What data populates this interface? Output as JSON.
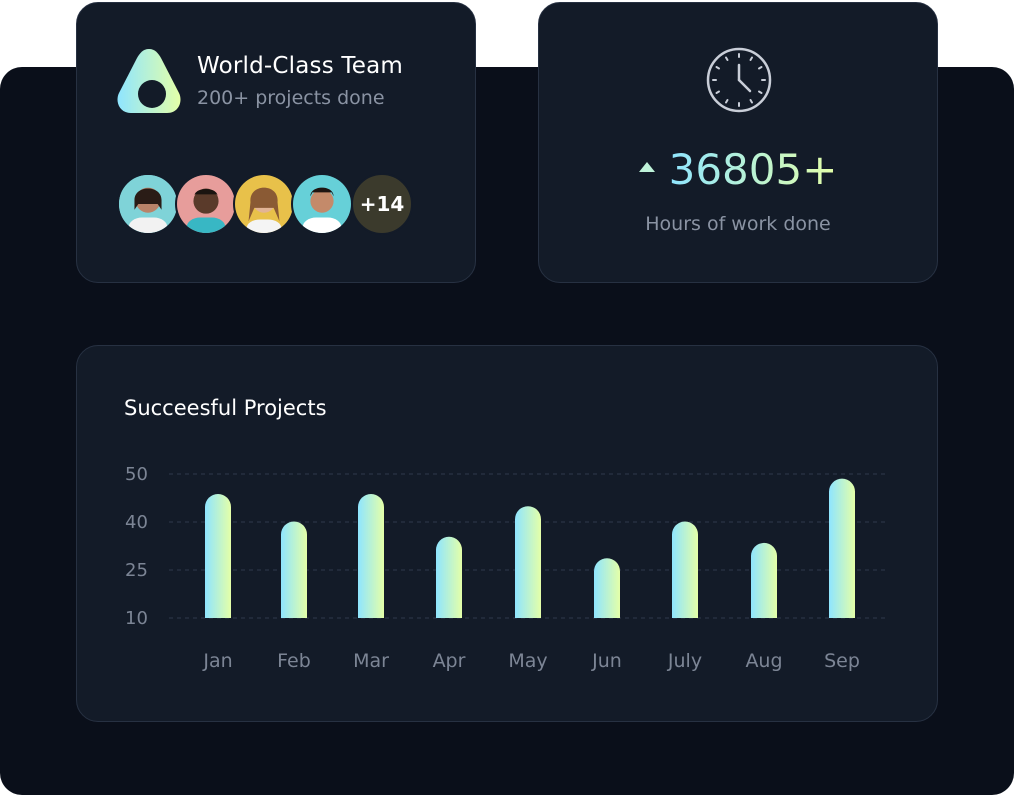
{
  "team": {
    "title": "World-Class Team",
    "subtitle": "200+ projects done",
    "avatars_more": "+14"
  },
  "hours": {
    "value": "36805+",
    "label": "Hours of work done",
    "trend": "up"
  },
  "colors": {
    "card_bg": "#131b28",
    "backdrop": "#0a0f1a",
    "gradient_start": "#8fe5ff",
    "gradient_end": "#e4ffa8"
  },
  "chart_data": {
    "type": "bar",
    "title": "Succeesful Projects",
    "categories": [
      "Jan",
      "Feb",
      "Mar",
      "Apr",
      "May",
      "Jun",
      "July",
      "Aug",
      "Sep"
    ],
    "values": [
      44,
      35,
      44,
      30,
      40,
      23,
      35,
      28,
      49
    ],
    "ytick_labels": [
      "50",
      "40",
      "25",
      "10"
    ],
    "grid": true
  }
}
